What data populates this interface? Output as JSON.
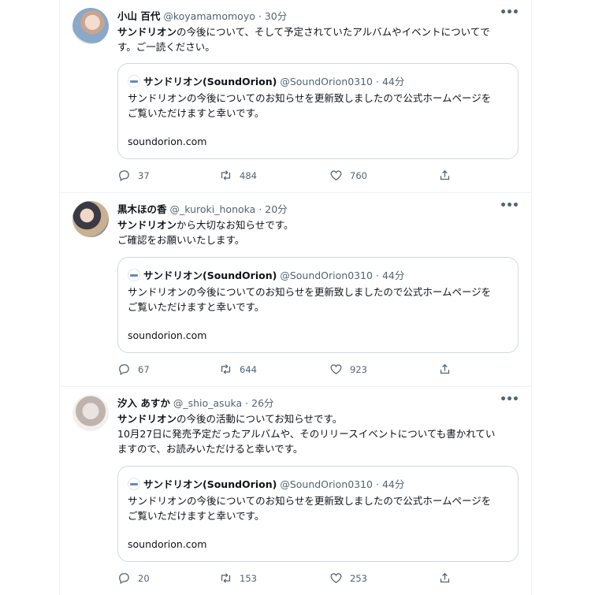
{
  "quoted": {
    "name": "サンドリオン(SoundOrion)",
    "handle": "@SoundOrion0310",
    "time": "44分",
    "body_line1": "サンドリオンの今後についてのお知らせを更新致しましたので公式ホームページを",
    "body_line2": "ご覧いただけますと幸いです。",
    "link": "soundorion.com"
  },
  "tweets": [
    {
      "name": "小山 百代",
      "handle": "@koyamamomoyo",
      "sep": "·",
      "time": "30分",
      "bold": "サンドリオン",
      "text_a": "の今後について、そして予定されていたアルバムやイベントについてで",
      "text_b": "す。ご一読ください。",
      "reply_count": "37",
      "retweet_count": "484",
      "like_count": "760"
    },
    {
      "name": "黒木ほの香",
      "handle": "@_kuroki_honoka",
      "sep": "·",
      "time": "20分",
      "bold": "サンドリオン",
      "text_a": "から大切なお知らせです。",
      "text_b": "ご確認をお願いいたします。",
      "reply_count": "67",
      "retweet_count": "644",
      "like_count": "923"
    },
    {
      "name": "汐入 あすか",
      "handle": "@_shio_asuka",
      "sep": "·",
      "time": "26分",
      "bold": "サンドリオン",
      "text_a": "の今後の活動についてお知らせです。",
      "text_b": "10月27日に発売予定だったアルバムや、そのリリースイベントについても書かれてい",
      "text_c": "ますので、お読みいただけると幸いです。",
      "reply_count": "20",
      "retweet_count": "153",
      "like_count": "253"
    }
  ],
  "icons": {
    "more": "more-icon",
    "reply": "reply-icon",
    "retweet": "retweet-icon",
    "like": "heart-icon",
    "share": "share-icon"
  },
  "colors": {
    "text": "#0f1419",
    "secondary": "#536471",
    "border": "#cfd9de",
    "divider": "#eff3f4"
  }
}
